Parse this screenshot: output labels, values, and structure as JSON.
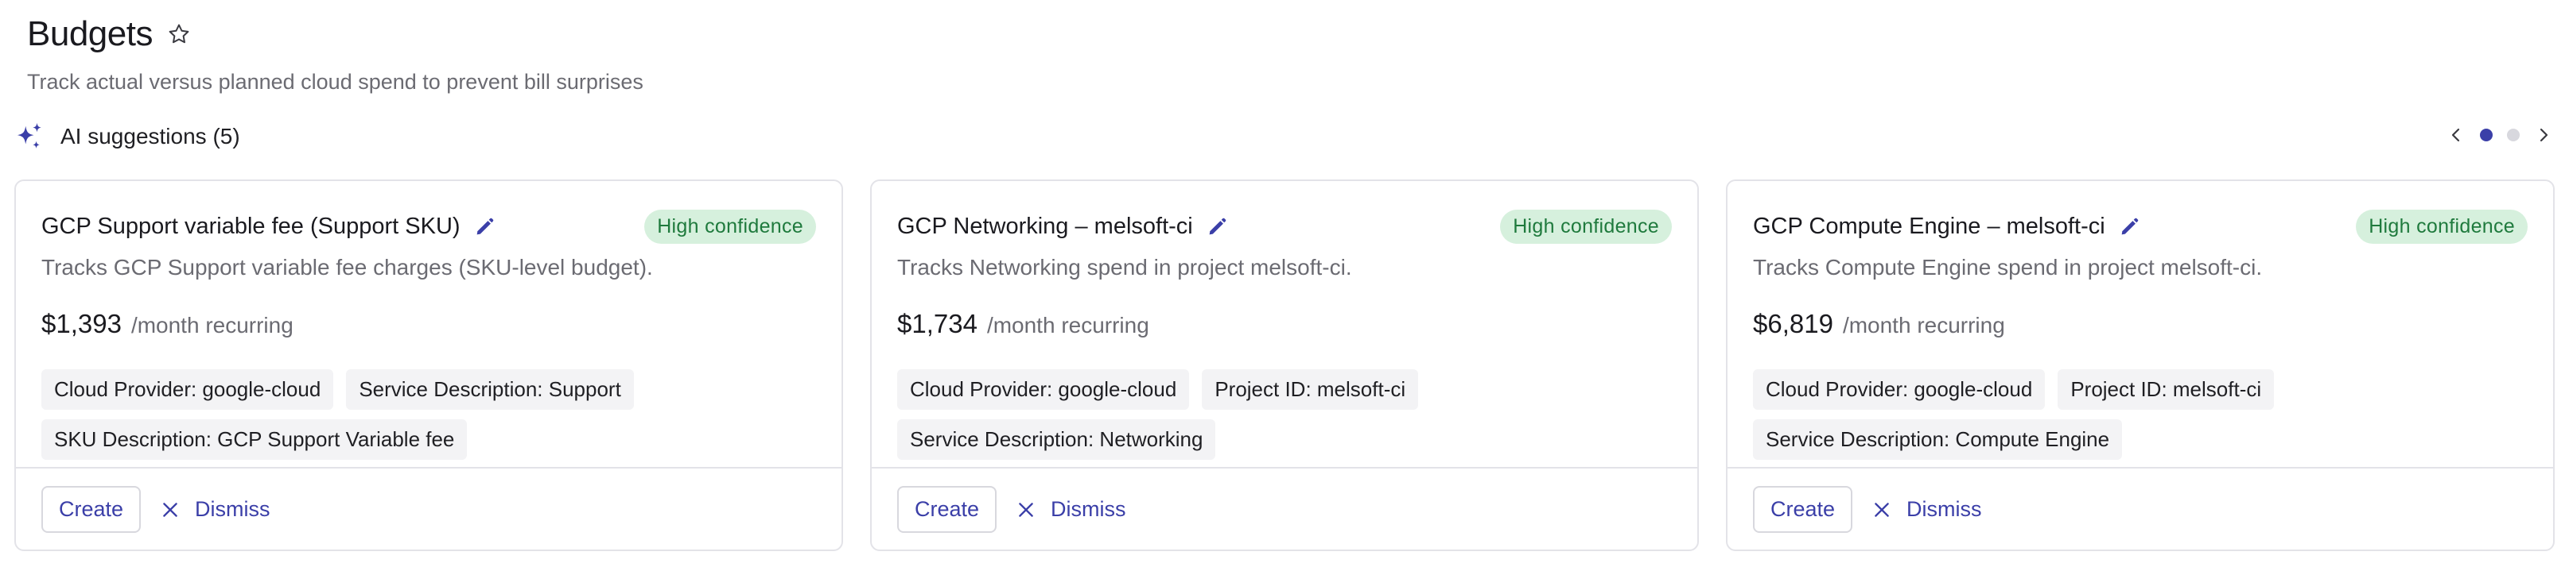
{
  "header": {
    "title": "Budgets",
    "subtitle": "Track actual versus planned cloud spend to prevent bill surprises"
  },
  "ai_suggestions": {
    "label": "AI suggestions (5)",
    "icon": "sparkle-icon",
    "pager": {
      "total_pages": 2,
      "current_page": 1
    }
  },
  "cards": [
    {
      "title": "GCP Support variable fee (Support SKU)",
      "badge": "High confidence",
      "description": "Tracks GCP Support variable fee charges (SKU-level budget).",
      "price": "$1,393",
      "price_suffix": "/month recurring",
      "tags": [
        "Cloud Provider: google-cloud",
        "Service Description: Support",
        "SKU Description: GCP Support Variable fee"
      ],
      "create_label": "Create",
      "dismiss_label": "Dismiss"
    },
    {
      "title": "GCP Networking – melsoft-ci",
      "badge": "High confidence",
      "description": "Tracks Networking spend in project melsoft-ci.",
      "price": "$1,734",
      "price_suffix": "/month recurring",
      "tags": [
        "Cloud Provider: google-cloud",
        "Project ID: melsoft-ci",
        "Service Description: Networking"
      ],
      "create_label": "Create",
      "dismiss_label": "Dismiss"
    },
    {
      "title": "GCP Compute Engine – melsoft-ci",
      "badge": "High confidence",
      "description": "Tracks Compute Engine spend in project melsoft-ci.",
      "price": "$6,819",
      "price_suffix": "/month recurring",
      "tags": [
        "Cloud Provider: google-cloud",
        "Project ID: melsoft-ci",
        "Service Description: Compute Engine"
      ],
      "create_label": "Create",
      "dismiss_label": "Dismiss"
    }
  ],
  "colors": {
    "accent": "#3b3fa8",
    "badge_bg": "#d6f0dd",
    "badge_text": "#1f7a3d",
    "tag_bg": "#f3f3f5",
    "muted_text": "#6b6b72"
  }
}
